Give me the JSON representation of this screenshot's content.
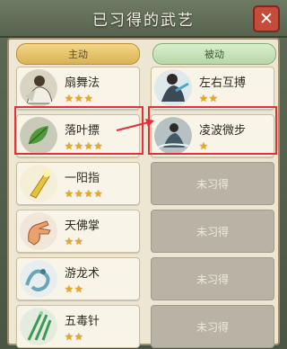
{
  "window": {
    "title": "已习得的武艺"
  },
  "close_label": "✕",
  "tabs": {
    "active": "主动",
    "passive": "被动"
  },
  "active_skills": [
    {
      "name": "扇舞法",
      "stars": 3,
      "icon": "fan-dancer-icon"
    },
    {
      "name": "落叶摽",
      "stars": 4,
      "icon": "leaf-icon"
    },
    {
      "name": "一阳指",
      "stars": 4,
      "icon": "golden-finger-icon"
    },
    {
      "name": "天佛掌",
      "stars": 2,
      "icon": "palm-icon"
    },
    {
      "name": "游龙术",
      "stars": 2,
      "icon": "dragon-icon"
    },
    {
      "name": "五毒针",
      "stars": 2,
      "icon": "poison-needle-icon"
    }
  ],
  "passive_skills": [
    {
      "name": "左右互搏",
      "stars": 2,
      "icon": "dual-fighter-icon",
      "learned": true
    },
    {
      "name": "凌波微步",
      "stars": 1,
      "icon": "light-step-icon",
      "learned": true
    },
    {
      "name": "未习得",
      "learned": false
    },
    {
      "name": "未习得",
      "learned": false
    },
    {
      "name": "未习得",
      "learned": false
    },
    {
      "name": "未习得",
      "learned": false
    }
  ],
  "colors": {
    "highlight": "#e3303a",
    "star": "#e9a922"
  }
}
